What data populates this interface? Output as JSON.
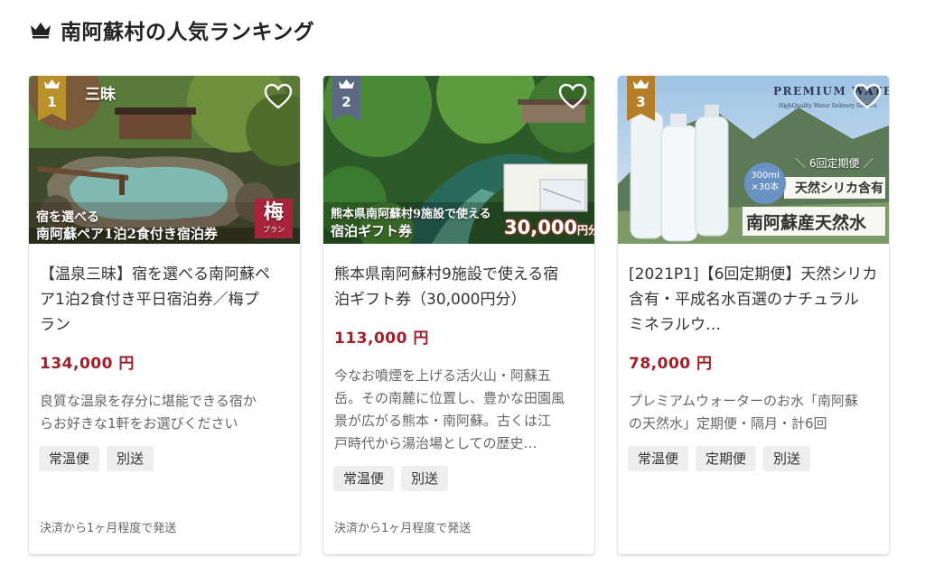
{
  "section": {
    "title": "南阿蘇村の人気ランキング",
    "title_icon": "crown-icon"
  },
  "colors": {
    "price": "#a0202a",
    "rank_gold": "#b8912b",
    "rank_slate": "#5b6a82",
    "rank_bronze": "#b57f2a",
    "tag_bg": "#eeeeee"
  },
  "cards": [
    {
      "rank": "1",
      "image_text": {
        "corner": "三昧",
        "line1": "宿を選べる",
        "line2": "南阿蘇ペア1泊2食付き宿泊券",
        "stamp": "梅",
        "stamp_sub": "プラン"
      },
      "title": "【温泉三昧】宿を選べる南阿蘇ペア1泊2食付き平日宿泊券／梅プラン",
      "title_lines": [
        "【温泉三昧】宿を選べる南阿蘇ペ",
        "ア1泊2食付き平日宿泊券／梅プ",
        "ラン"
      ],
      "price": "134,000 円",
      "description": "良質な温泉を存分に堪能できる宿からお好きな1軒をお選びください",
      "description_lines": [
        "良質な温泉を存分に堪能できる宿か",
        "らお好きな1軒をお選びください"
      ],
      "tags": [
        "常温便",
        "別送"
      ],
      "shipping": "決済から1ヶ月程度で発送"
    },
    {
      "rank": "2",
      "image_text": {
        "line1": "熊本県南阿蘇村9施設で使える",
        "line2": "宿泊ギフト券",
        "amount": "30,000",
        "amount_unit": "円分"
      },
      "title": "熊本県南阿蘇村9施設で使える宿泊ギフト券（30,000円分）",
      "title_lines": [
        "熊本県南阿蘇村9施設で使える宿",
        "泊ギフト券（30,000円分）"
      ],
      "price": "113,000 円",
      "description": "今なお噴煙を上げる活火山・阿蘇五岳。その南麓に位置し、豊かな田園風景が広がる熊本・南阿蘇。古くは江戸時代から湯治場としての歴史…",
      "description_lines": [
        "今なお噴煙を上げる活火山・阿蘇五",
        "岳。その南麓に位置し、豊かな田園風",
        "景が広がる熊本・南阿蘇。古くは江",
        "戸時代から湯治場としての歴史…"
      ],
      "tags": [
        "常温便",
        "別送"
      ],
      "shipping": "決済から1ヶ月程度で発送"
    },
    {
      "rank": "3",
      "image_text": {
        "brand": "PREMIUM WATER",
        "tagline": "HighQuality Water Delivery Service",
        "badge_line1": "300ml",
        "badge_line2": "×30本",
        "line1": "＼ 6回定期便 ／",
        "line2": "天然シリカ含有",
        "line3": "南阿蘇産天然水"
      },
      "title": "[2021P1]【6回定期便】天然シリカ含有・平成名水百選のナチュラルミネラルウ…",
      "title_lines": [
        "[2021P1]【6回定期便】天然シリカ",
        "含有・平成名水百選のナチュラル",
        "ミネラルウ…"
      ],
      "price": "78,000 円",
      "description": "プレミアムウォーターのお水「南阿蘇の天然水」定期便・隔月・計6回",
      "description_lines": [
        "プレミアムウォーターのお水「南阿蘇",
        "の天然水」定期便・隔月・計6回"
      ],
      "tags": [
        "常温便",
        "定期便",
        "別送"
      ],
      "shipping": ""
    }
  ]
}
